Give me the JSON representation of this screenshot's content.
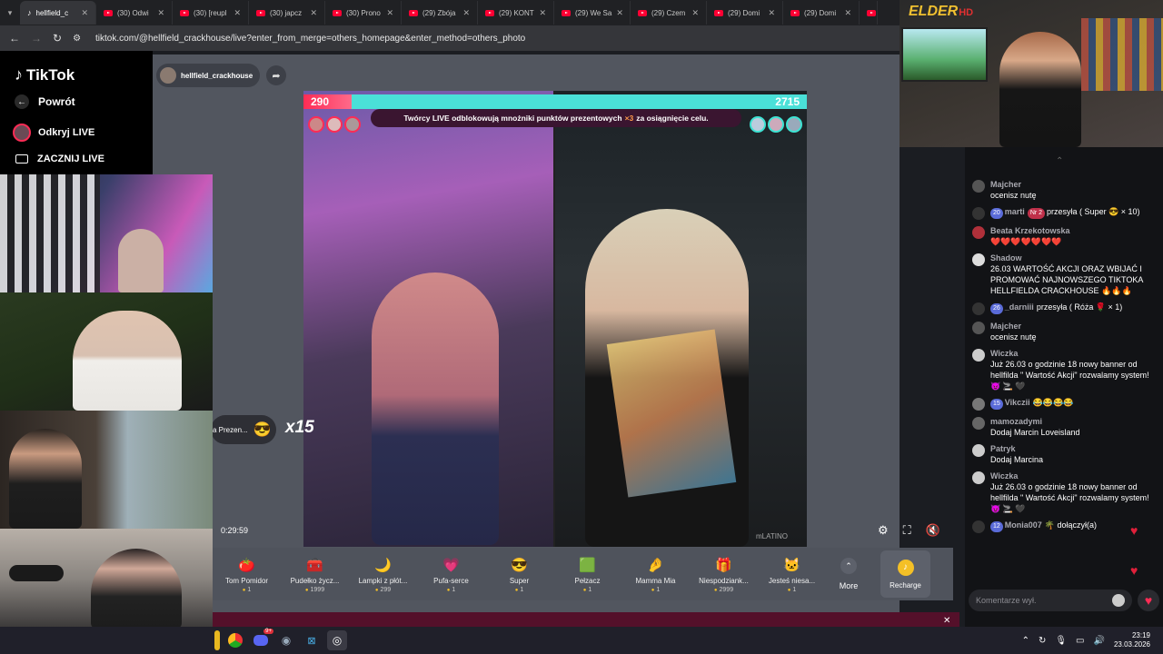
{
  "tabs": [
    {
      "label": "hellfield_c",
      "active": true,
      "icon": "tiktok-icon"
    },
    {
      "label": "(30) Odwi",
      "icon": "youtube-icon"
    },
    {
      "label": "(30) [reupl",
      "icon": "youtube-icon"
    },
    {
      "label": "(30) japcz",
      "icon": "youtube-icon"
    },
    {
      "label": "(30) Prono",
      "icon": "youtube-icon"
    },
    {
      "label": "(29) Zbója",
      "icon": "youtube-icon"
    },
    {
      "label": "(29) KONT",
      "icon": "youtube-icon"
    },
    {
      "label": "(29) We Sa",
      "icon": "youtube-icon"
    },
    {
      "label": "(29) Czem",
      "icon": "youtube-icon"
    },
    {
      "label": "(29) Domi",
      "icon": "youtube-icon"
    },
    {
      "label": "(29) Domi",
      "icon": "youtube-icon"
    },
    {
      "label": "Je",
      "icon": "youtube-icon"
    }
  ],
  "address": {
    "url": "tiktok.com/@hellfield_crackhouse/live?enter_from_merge=others_homepage&enter_method=others_photo"
  },
  "sidebar": {
    "logo": "TikTok",
    "back": "Powrót",
    "discover": "Odkryj LIVE",
    "start": "ZACZNIJ LIVE"
  },
  "stage": {
    "host_name": "hellfield_crackhouse",
    "score_left": "290",
    "score_right": "2715",
    "banner_text_a": "Twórcy LIVE odblokowują mnożniki punktów prezentowych",
    "banner_mult": "×3",
    "banner_text_b": "za osiągnięcie celu.",
    "timer": "0:29:59",
    "gift_popup_text": "a Prezen...",
    "gift_popup_count": "x15",
    "watermark": "mLATINO"
  },
  "gifts": [
    {
      "name": "Tom Pomidor",
      "price": "1",
      "icon": "🍅"
    },
    {
      "name": "Pudełko życz...",
      "price": "1999",
      "icon": "🧰"
    },
    {
      "name": "Lampki z płót...",
      "price": "299",
      "icon": "🌙"
    },
    {
      "name": "Pufa-serce",
      "price": "1",
      "icon": "💗"
    },
    {
      "name": "Super",
      "price": "1",
      "icon": "😎"
    },
    {
      "name": "Pełzacz",
      "price": "1",
      "icon": "🟩"
    },
    {
      "name": "Mamma Mia",
      "price": "1",
      "icon": "🤌"
    },
    {
      "name": "Niespodziank...",
      "price": "2999",
      "icon": "🎁"
    },
    {
      "name": "Jesteś niesa...",
      "price": "1",
      "icon": "🐱"
    }
  ],
  "giftbar": {
    "more": "More",
    "recharge": "Recharge"
  },
  "streamer_overlay": {
    "logo_text": "ELDER",
    "logo_sub": "HD"
  },
  "chat": [
    {
      "user": "Majcher",
      "text": "ocenisz nutę",
      "avatar": "#555"
    },
    {
      "user": "",
      "badges": [
        {
          "t": "20",
          "c": "#5a6bd8"
        }
      ],
      "inline_user": "marti",
      "inline_badge": "Nr 2",
      "text": "przesyła ( Super 😎 × 10)",
      "avatar": "#333"
    },
    {
      "user": "Beata Krzekotowska",
      "text": "❤️❤️❤️❤️❤️❤️❤️",
      "avatar": "#b0303a"
    },
    {
      "user": "Shadow",
      "text": "26.03 WARTOŚĆ AKCJI ORAZ WBIJAĆ I PROMOWAĆ NAJNOWSZEGO TIKTOKA HELLFIELDA CRACKHOUSE 🔥🔥🔥",
      "avatar": "#ddd"
    },
    {
      "user": "",
      "badges": [
        {
          "t": "26",
          "c": "#5a6bd8"
        }
      ],
      "inline_user": "_darniii",
      "text": "przesyła ( Róża 🌹 × 1)",
      "avatar": "#333"
    },
    {
      "user": "Majcher",
      "text": "ocenisz nutę",
      "avatar": "#555"
    },
    {
      "user": "Wiczka",
      "text": "Już 26.03 o godzinie 18 nowy banner od hellfilda \" Wartość Akcji\" rozwalamy system! 😈 🚬 🖤",
      "avatar": "#ccc"
    },
    {
      "user": "",
      "badges": [
        {
          "t": "15",
          "c": "#5a6bd8"
        }
      ],
      "inline_user": "Vikczii",
      "text": "😂😂😂😂",
      "avatar": "#777"
    },
    {
      "user": "mamozadymi",
      "text": "Dodaj Marcin Loveisland",
      "avatar": "#666"
    },
    {
      "user": "Patryk",
      "text": "Dodaj Marcina",
      "avatar": "#ccc"
    },
    {
      "user": "Wiczka",
      "text": "Już 26.03 o godzinie 18 nowy banner od hellfilda \" Wartość Akcji\" rozwalamy system! 😈 🚬 🖤",
      "avatar": "#ccc"
    },
    {
      "user": "",
      "badges": [
        {
          "t": "12",
          "c": "#5a6bd8"
        }
      ],
      "inline_user": "Monia007",
      "text": "🌴 dołączył(a)",
      "avatar": "#333"
    }
  ],
  "chat_input": {
    "placeholder": "Komentarze wył."
  },
  "taskbar": {
    "time": "23:19",
    "date": "23.03.2026",
    "discord_badge": "9+"
  },
  "colors": {
    "tiktok_pink": "#fe2c55",
    "teal": "#3de3d3",
    "gift_bar": "#4f535c"
  }
}
